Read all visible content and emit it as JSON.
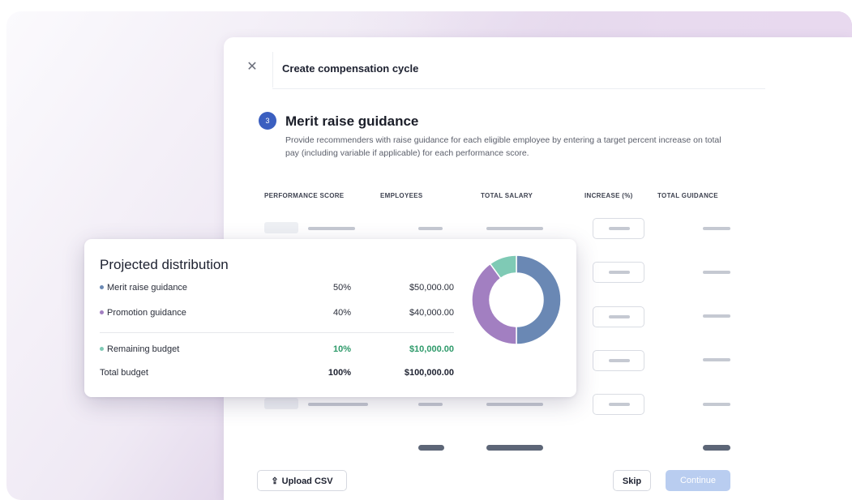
{
  "modal": {
    "title": "Create compensation cycle",
    "close_icon": "close-icon",
    "step_number": "3",
    "section_title": "Merit raise guidance",
    "section_description": "Provide recommenders with raise guidance for each eligible employee by entering a target percent increase on total pay (including variable if applicable) for each performance score.",
    "table_headers": [
      "PERFORMANCE SCORE",
      "EMPLOYEES",
      "TOTAL SALARY",
      "INCREASE (%)",
      "TOTAL GUIDANCE"
    ],
    "footer": {
      "upload_label": "Upload CSV",
      "upload_icon": "upload-icon",
      "skip_label": "Skip",
      "continue_label": "Continue"
    }
  },
  "distribution_card": {
    "title": "Projected distribution",
    "rows": [
      {
        "label": "Merit raise guidance",
        "percent": "50%",
        "amount": "$50,000.00",
        "color": "#6a88b4"
      },
      {
        "label": "Promotion guidance",
        "percent": "40%",
        "amount": "$40,000.00",
        "color": "#a27fc1"
      },
      {
        "label": "Remaining budget",
        "percent": "10%",
        "amount": "$10,000.00",
        "color": "#7fcab5"
      }
    ],
    "total": {
      "label": "Total budget",
      "percent": "100%",
      "amount": "$100,000.00"
    }
  },
  "chart_data": {
    "type": "pie",
    "categories": [
      "Merit raise guidance",
      "Promotion guidance",
      "Remaining budget"
    ],
    "values": [
      50,
      40,
      10
    ],
    "colors": [
      "#6a88b4",
      "#a27fc1",
      "#7fcab5"
    ],
    "title": ""
  },
  "colors": {
    "accent": "#3b5fc0",
    "continue_disabled": "#b9cdf0",
    "remaining_green": "#2e9a6a"
  }
}
